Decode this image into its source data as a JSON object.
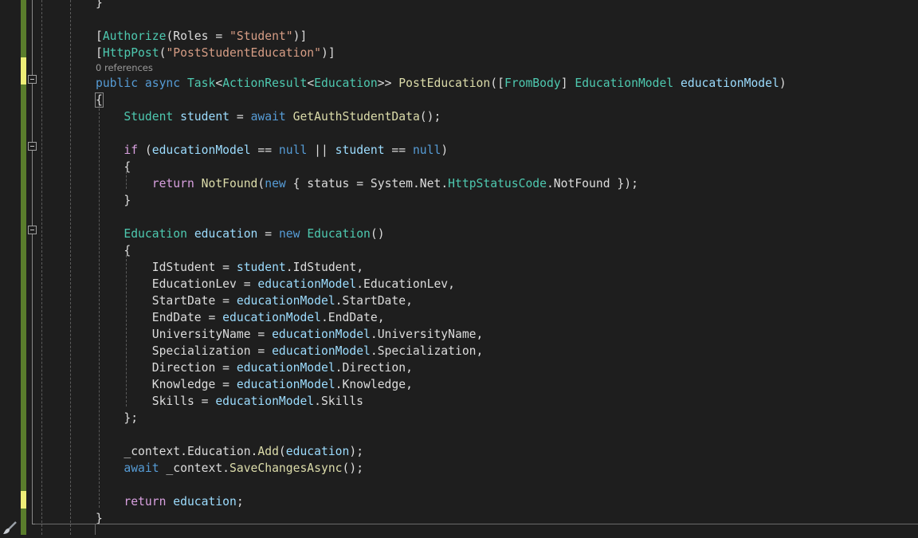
{
  "editor": {
    "codelens": "0 references",
    "lines": [
      {
        "tokens": [
          [
            "p",
            "}"
          ]
        ]
      },
      {
        "tokens": []
      },
      {
        "tokens": [
          [
            "p",
            "["
          ],
          [
            "t",
            "Authorize"
          ],
          [
            "p",
            "(Roles = "
          ],
          [
            "s",
            "\"Student\""
          ],
          [
            "p",
            ")]"
          ]
        ]
      },
      {
        "tokens": [
          [
            "p",
            "["
          ],
          [
            "t",
            "HttpPost"
          ],
          [
            "p",
            "("
          ],
          [
            "s",
            "\"PostStudentEducation\""
          ],
          [
            "p",
            ")]"
          ]
        ]
      },
      {
        "lens": true
      },
      {
        "tokens": [
          [
            "k",
            "public"
          ],
          [
            "p",
            " "
          ],
          [
            "k",
            "async"
          ],
          [
            "p",
            " "
          ],
          [
            "t",
            "Task"
          ],
          [
            "p",
            "<"
          ],
          [
            "t",
            "ActionResult"
          ],
          [
            "p",
            "<"
          ],
          [
            "t",
            "Education"
          ],
          [
            "p",
            ">> "
          ],
          [
            "m",
            "PostEducation"
          ],
          [
            "p",
            "(["
          ],
          [
            "t",
            "FromBody"
          ],
          [
            "p",
            "] "
          ],
          [
            "t",
            "EducationModel"
          ],
          [
            "p",
            " "
          ],
          [
            "v",
            "educationModel"
          ],
          [
            "p",
            ")"
          ]
        ]
      },
      {
        "tokens": [
          [
            "p",
            "{"
          ]
        ],
        "hl": true
      },
      {
        "tokens": [
          [
            "p",
            "    "
          ],
          [
            "t",
            "Student"
          ],
          [
            "p",
            " "
          ],
          [
            "v",
            "student"
          ],
          [
            "p",
            " = "
          ],
          [
            "k",
            "await"
          ],
          [
            "p",
            " "
          ],
          [
            "m",
            "GetAuthStudentData"
          ],
          [
            "p",
            "();"
          ]
        ]
      },
      {
        "tokens": []
      },
      {
        "tokens": [
          [
            "p",
            "    "
          ],
          [
            "ck",
            "if"
          ],
          [
            "p",
            " ("
          ],
          [
            "v",
            "educationModel"
          ],
          [
            "p",
            " == "
          ],
          [
            "k",
            "null"
          ],
          [
            "p",
            " || "
          ],
          [
            "v",
            "student"
          ],
          [
            "p",
            " == "
          ],
          [
            "k",
            "null"
          ],
          [
            "p",
            ")"
          ]
        ]
      },
      {
        "tokens": [
          [
            "p",
            "    {"
          ]
        ]
      },
      {
        "tokens": [
          [
            "p",
            "        "
          ],
          [
            "ck",
            "return"
          ],
          [
            "p",
            " "
          ],
          [
            "m",
            "NotFound"
          ],
          [
            "p",
            "("
          ],
          [
            "k",
            "new"
          ],
          [
            "p",
            " { status = System.Net."
          ],
          [
            "t",
            "HttpStatusCode"
          ],
          [
            "p",
            ".NotFound });"
          ]
        ]
      },
      {
        "tokens": [
          [
            "p",
            "    }"
          ]
        ]
      },
      {
        "tokens": []
      },
      {
        "tokens": [
          [
            "p",
            "    "
          ],
          [
            "t",
            "Education"
          ],
          [
            "p",
            " "
          ],
          [
            "v",
            "education"
          ],
          [
            "p",
            " = "
          ],
          [
            "k",
            "new"
          ],
          [
            "p",
            " "
          ],
          [
            "t",
            "Education"
          ],
          [
            "p",
            "()"
          ]
        ]
      },
      {
        "tokens": [
          [
            "p",
            "    {"
          ]
        ]
      },
      {
        "tokens": [
          [
            "p",
            "        IdStudent = "
          ],
          [
            "v",
            "student"
          ],
          [
            "p",
            ".IdStudent,"
          ]
        ]
      },
      {
        "tokens": [
          [
            "p",
            "        EducationLev = "
          ],
          [
            "v",
            "educationModel"
          ],
          [
            "p",
            ".EducationLev,"
          ]
        ]
      },
      {
        "tokens": [
          [
            "p",
            "        StartDate = "
          ],
          [
            "v",
            "educationModel"
          ],
          [
            "p",
            ".StartDate,"
          ]
        ]
      },
      {
        "tokens": [
          [
            "p",
            "        EndDate = "
          ],
          [
            "v",
            "educationModel"
          ],
          [
            "p",
            ".EndDate,"
          ]
        ]
      },
      {
        "tokens": [
          [
            "p",
            "        UniversityName = "
          ],
          [
            "v",
            "educationModel"
          ],
          [
            "p",
            ".UniversityName,"
          ]
        ]
      },
      {
        "tokens": [
          [
            "p",
            "        Specialization = "
          ],
          [
            "v",
            "educationModel"
          ],
          [
            "p",
            ".Specialization,"
          ]
        ]
      },
      {
        "tokens": [
          [
            "p",
            "        Direction = "
          ],
          [
            "v",
            "educationModel"
          ],
          [
            "p",
            ".Direction,"
          ]
        ]
      },
      {
        "tokens": [
          [
            "p",
            "        Knowledge = "
          ],
          [
            "v",
            "educationModel"
          ],
          [
            "p",
            ".Knowledge,"
          ]
        ]
      },
      {
        "tokens": [
          [
            "p",
            "        Skills = "
          ],
          [
            "v",
            "educationModel"
          ],
          [
            "p",
            ".Skills"
          ]
        ]
      },
      {
        "tokens": [
          [
            "p",
            "    };"
          ]
        ]
      },
      {
        "tokens": []
      },
      {
        "tokens": [
          [
            "p",
            "    _context.Education."
          ],
          [
            "m",
            "Add"
          ],
          [
            "p",
            "("
          ],
          [
            "v",
            "education"
          ],
          [
            "p",
            ");"
          ]
        ]
      },
      {
        "tokens": [
          [
            "p",
            "    "
          ],
          [
            "k",
            "await"
          ],
          [
            "p",
            " _context."
          ],
          [
            "m",
            "SaveChangesAsync"
          ],
          [
            "p",
            "();"
          ]
        ]
      },
      {
        "tokens": []
      },
      {
        "tokens": [
          [
            "p",
            "    "
          ],
          [
            "ck",
            "return"
          ],
          [
            "p",
            " "
          ],
          [
            "v",
            "education"
          ],
          [
            "p",
            ";"
          ]
        ]
      },
      {
        "tokens": [
          [
            "p",
            "}"
          ]
        ]
      }
    ]
  },
  "colors": {
    "background": "#1e1e1e",
    "keyword": "#569cd6",
    "type": "#4ec9b0",
    "string": "#d69d85",
    "method": "#dcdcaa",
    "control": "#d8a0df",
    "variable": "#9cdcfe",
    "saved_change": "#5a7d2c",
    "unsaved_change": "#eeee77"
  }
}
